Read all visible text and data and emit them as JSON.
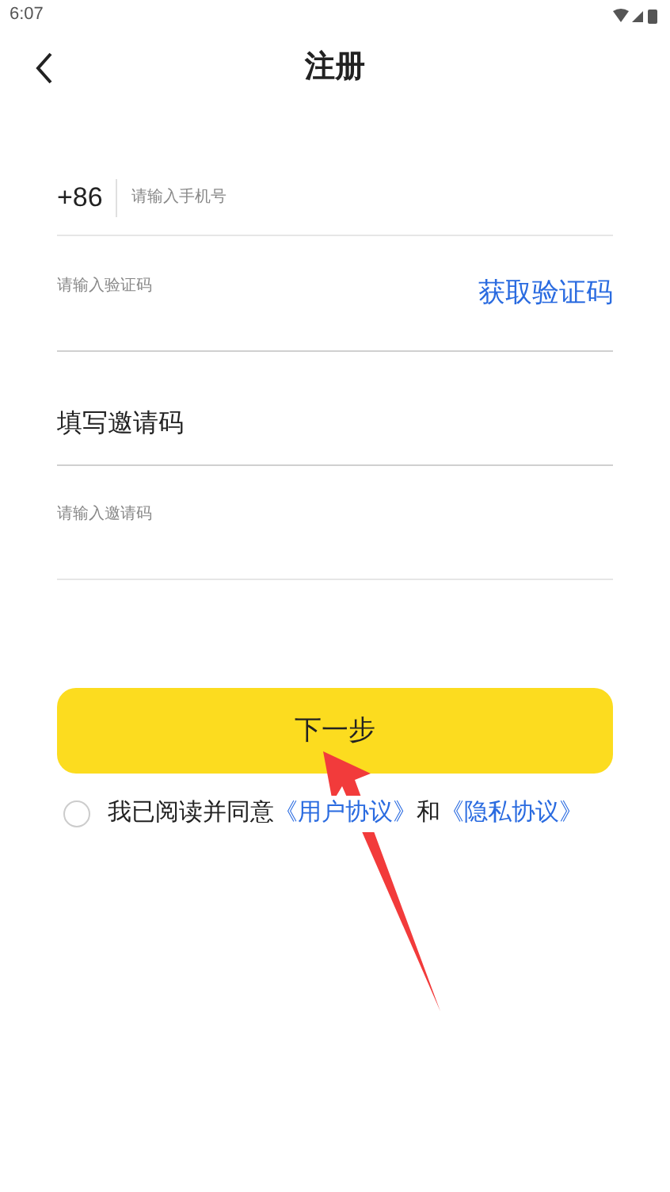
{
  "status_bar": {
    "time": "6:07"
  },
  "header": {
    "title": "注册"
  },
  "phone": {
    "prefix": "+86",
    "placeholder": "请输入手机号"
  },
  "code": {
    "placeholder": "请输入验证码",
    "action": "获取验证码"
  },
  "invite": {
    "heading": "填写邀请码",
    "placeholder": "请输入邀请码"
  },
  "next_button": "下一步",
  "agreement": {
    "checked": false,
    "text": "我已阅读并同意",
    "link_1": "《用户协议》",
    "joiner": "和",
    "link_2": "《隐私协议》"
  }
}
